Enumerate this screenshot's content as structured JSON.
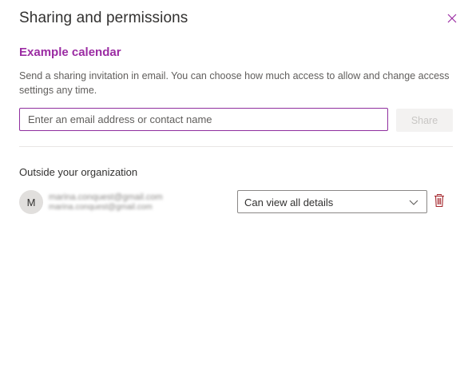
{
  "dialog": {
    "title": "Sharing and permissions",
    "calendar_name": "Example calendar",
    "description": "Send a sharing invitation in email. You can choose how much access to allow and change access settings any time."
  },
  "invite": {
    "placeholder": "Enter an email address or contact name",
    "value": "",
    "share_label": "Share"
  },
  "outside_section": {
    "title": "Outside your organization",
    "people": [
      {
        "initial": "M",
        "name": "marina.conquest@gmail.com",
        "email": "marina.conquest@gmail.com",
        "permission": "Can view all details"
      }
    ]
  },
  "icons": {
    "close": "close-icon",
    "chevron": "chevron-down-icon",
    "delete": "trash-icon"
  },
  "colors": {
    "accent": "#9b2ca3",
    "delete_icon": "#a4262c"
  }
}
